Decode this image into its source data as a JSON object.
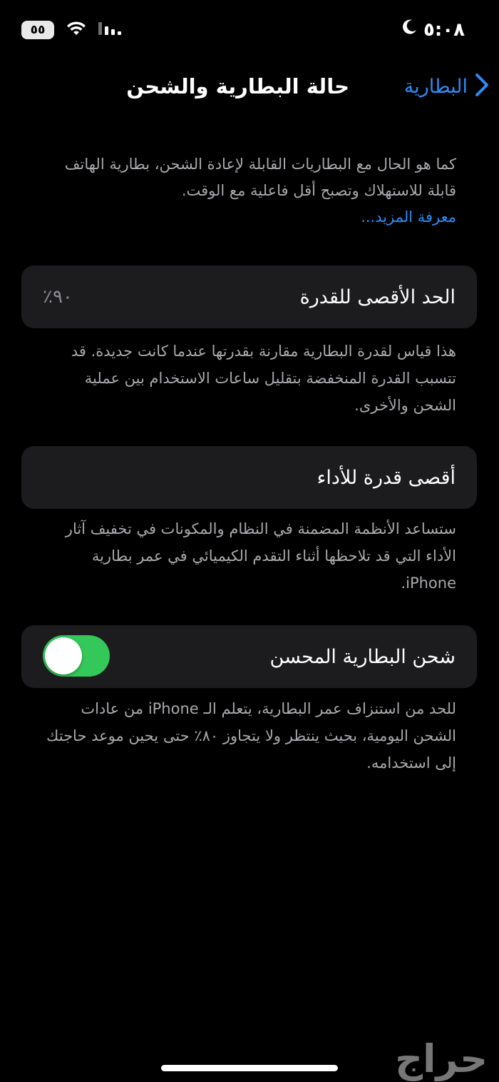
{
  "status_bar": {
    "time": "٥:٠٨",
    "battery_text": "٥٥",
    "icons": [
      "moon-icon",
      "wifi-icon",
      "signal-icon",
      "battery-icon"
    ]
  },
  "nav": {
    "back_label": "البطارية",
    "title": "حالة البطارية والشحن"
  },
  "intro": {
    "text": "كما هو الحال مع البطاريات القابلة لإعادة الشحن، بطارية الهاتف قابلة للاستهلاك وتصبح أقل فاعلية مع الوقت.",
    "link": "معرفة المزيد..."
  },
  "max_capacity": {
    "label": "الحد الأقصى للقدرة",
    "value": "٪٩٠",
    "footnote": "هذا قياس لقدرة البطارية مقارنة بقدرتها عندما كانت جديدة. قد تتسبب القدرة المنخفضة بتقليل ساعات الاستخدام بين عملية الشحن والأخرى."
  },
  "peak_performance": {
    "label": "أقصى قدرة للأداء",
    "footnote": "ستساعد الأنظمة المضمنة في النظام والمكونات في تخفيف آثار الأداء التي قد تلاحظها أثناء التقدم الكيميائي في عمر بطارية iPhone."
  },
  "optimized_charging": {
    "label": "شحن البطارية المحسن",
    "enabled": true,
    "footnote": "للحد من استنزاف عمر البطارية، يتعلم الـ iPhone من عادات الشحن اليومية، بحيث ينتظر ولا يتجاوز ٨٠٪ حتى يحين موعد حاجتك إلى استخدامه."
  },
  "watermark": "حراج",
  "colors": {
    "accent": "#2f8bf5",
    "toggle_on": "#34c759",
    "card_bg": "#1c1c1e",
    "secondary_text": "#a9a9ae"
  }
}
